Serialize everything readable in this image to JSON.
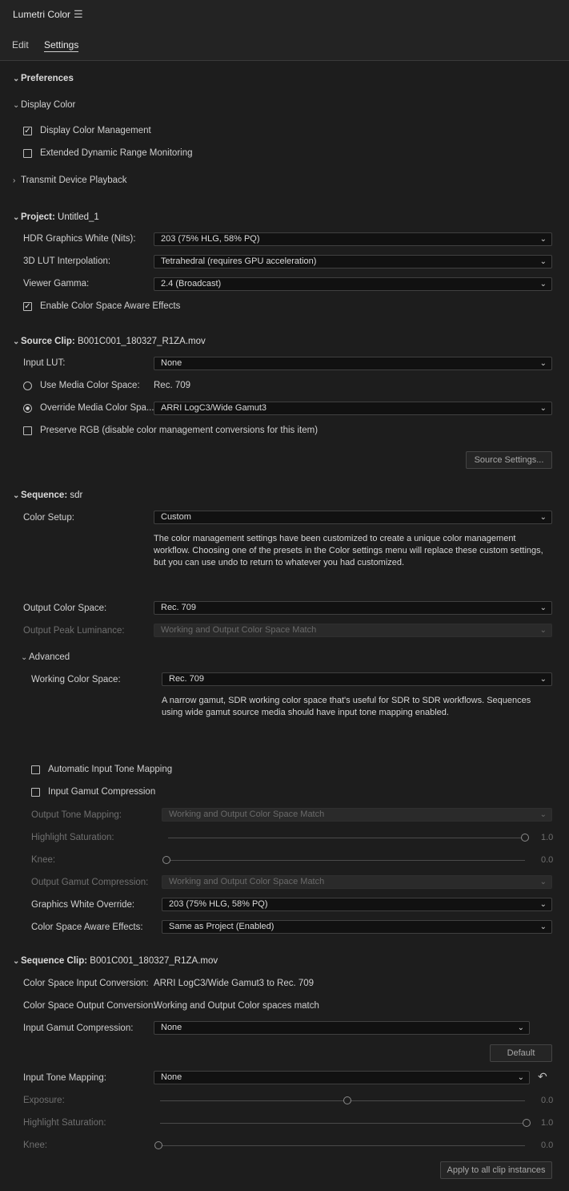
{
  "header": {
    "title": "Lumetri Color",
    "menu_icon": "hamburger-menu-icon"
  },
  "tabs": [
    {
      "label": "Edit",
      "active": false
    },
    {
      "label": "Settings",
      "active": true
    }
  ],
  "preferences": {
    "title": "Preferences"
  },
  "display_color": {
    "title": "Display Color",
    "display_color_management": {
      "label": "Display Color Management",
      "checked": true
    },
    "edr_monitoring": {
      "label": "Extended Dynamic Range Monitoring",
      "checked": false
    }
  },
  "transmit": {
    "title": "Transmit Device Playback"
  },
  "project": {
    "title": "Project:",
    "name": "Untitled_1",
    "hdr_white": {
      "label": "HDR Graphics White (Nits):",
      "value": "203 (75% HLG, 58% PQ)"
    },
    "lut_interp": {
      "label": "3D LUT Interpolation:",
      "value": "Tetrahedral (requires GPU acceleration)"
    },
    "viewer_gamma": {
      "label": "Viewer Gamma:",
      "value": "2.4 (Broadcast)"
    },
    "csa_effects": {
      "label": "Enable Color Space Aware Effects",
      "checked": true
    }
  },
  "source_clip": {
    "title": "Source Clip:",
    "name": "B001C001_180327_R1ZA.mov",
    "input_lut": {
      "label": "Input LUT:",
      "value": "None"
    },
    "use_media": {
      "label": "Use Media Color Space:",
      "value": "Rec. 709"
    },
    "override_media": {
      "label": "Override Media Color Spa...",
      "value": "ARRI LogC3/Wide Gamut3"
    },
    "preserve_rgb": {
      "label": "Preserve RGB (disable color management conversions for this item)",
      "checked": false
    },
    "source_settings_button": "Source Settings..."
  },
  "sequence": {
    "title": "Sequence:",
    "name": "sdr",
    "color_setup": {
      "label": "Color Setup:",
      "value": "Custom"
    },
    "color_setup_desc": "The color management settings have been customized to create a unique color management workflow. Choosing one of the presets in the Color settings menu will replace these custom settings, but you can use undo to return to whatever you had customized.",
    "output_cs": {
      "label": "Output Color Space:",
      "value": "Rec. 709"
    },
    "output_peak": {
      "label": "Output Peak Luminance:",
      "value": "Working and Output Color Space Match"
    },
    "advanced": {
      "title": "Advanced",
      "working_cs": {
        "label": "Working Color Space:",
        "value": "Rec. 709"
      },
      "working_desc": "A narrow gamut, SDR working color space that's useful for SDR to SDR workflows. Sequences using wide gamut source media should have input tone mapping enabled.",
      "auto_tone_mapping": {
        "label": "Automatic Input Tone Mapping",
        "checked": false
      },
      "gamut_compression": {
        "label": "Input Gamut Compression",
        "checked": false
      },
      "output_tone_mapping": {
        "label": "Output Tone Mapping:",
        "value": "Working and Output Color Space Match"
      },
      "highlight_sat": {
        "label": "Highlight Saturation:",
        "value": "1.0",
        "level": 1.0
      },
      "knee": {
        "label": "Knee:",
        "value": "0.0",
        "level": 0.0
      },
      "output_gamut": {
        "label": "Output Gamut Compression:",
        "value": "Working and Output Color Space Match"
      },
      "gfx_white": {
        "label": "Graphics White Override:",
        "value": "203 (75% HLG, 58% PQ)"
      },
      "csa": {
        "label": "Color Space Aware Effects:",
        "value": "Same as Project (Enabled)"
      }
    }
  },
  "seq_clip": {
    "title": "Sequence Clip:",
    "name": "B001C001_180327_R1ZA.mov",
    "input_conv": {
      "label": "Color Space Input Conversion:",
      "value": "ARRI LogC3/Wide Gamut3 to Rec. 709"
    },
    "output_conv": {
      "label": "Color Space Output Conversion:",
      "value": "Working and Output Color spaces match"
    },
    "input_gamut": {
      "label": "Input Gamut Compression:",
      "value": "None"
    },
    "default_button": "Default",
    "input_tone": {
      "label": "Input Tone Mapping:",
      "value": "None"
    },
    "exposure": {
      "label": "Exposure:",
      "value": "0.0",
      "level": 0.5
    },
    "highlight_sat": {
      "label": "Highlight Saturation:",
      "value": "1.0",
      "level": 1.0
    },
    "knee": {
      "label": "Knee:",
      "value": "0.0",
      "level": 0.0
    },
    "apply_button": "Apply to all clip instances"
  }
}
